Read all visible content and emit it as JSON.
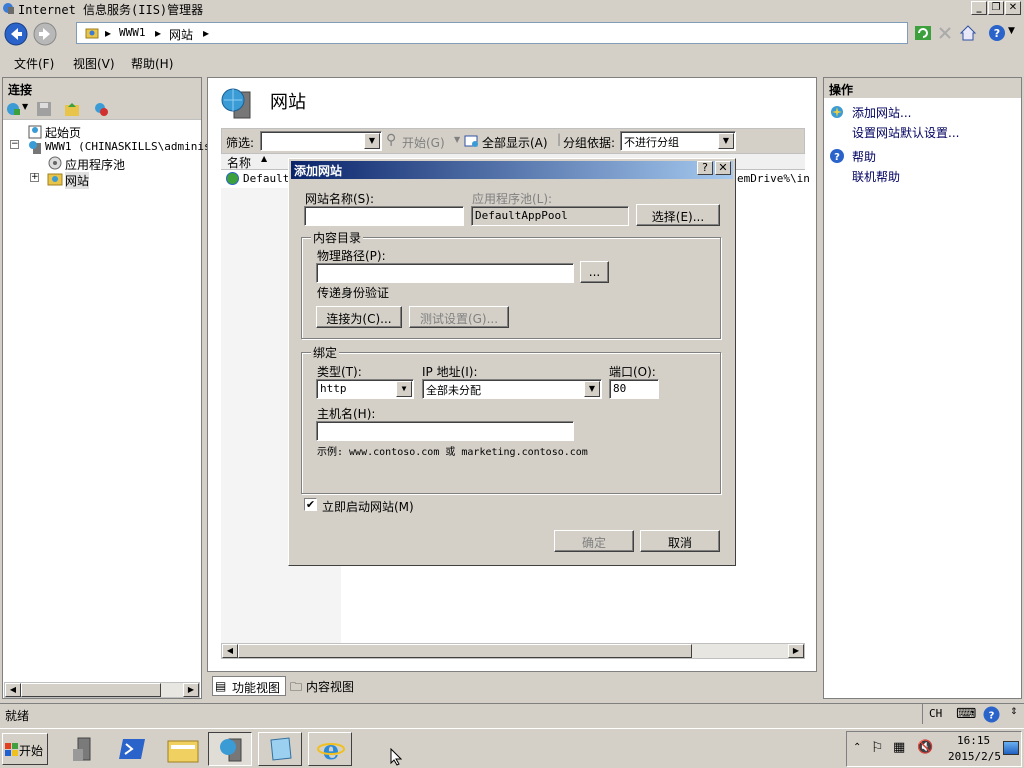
{
  "window": {
    "title": "Internet 信息服务(IIS)管理器"
  },
  "address": {
    "crumbs": [
      "WWW1",
      "网站"
    ]
  },
  "menu": {
    "file": "文件(F)",
    "view": "视图(V)",
    "help": "帮助(H)"
  },
  "connections": {
    "header": "连接",
    "tree": {
      "start_page": "起始页",
      "server": "WWW1 (CHINASKILLS\\administ",
      "app_pools": "应用程序池",
      "sites": "网站"
    }
  },
  "main": {
    "title": "网站",
    "filter_label": "筛选:",
    "start_label": "开始(G)",
    "show_all": "全部显示(A)",
    "group_by_label": "分组依据:",
    "group_by_value": "不进行分组",
    "col_name": "名称",
    "row_default": "Default",
    "row_path_frag": "emDrive%\\in"
  },
  "bottom_tabs": {
    "features": "功能视图",
    "content": "内容视图"
  },
  "actions": {
    "header": "操作",
    "add_site": "添加网站...",
    "set_defaults": "设置网站默认设置...",
    "help": "帮助",
    "online_help": "联机帮助"
  },
  "status": {
    "text": "就绪",
    "lang": "CH"
  },
  "dialog": {
    "title": "添加网站",
    "help_btn": "?",
    "site_name_label": "网站名称(S):",
    "site_name_value": "",
    "app_pool_label": "应用程序池(L):",
    "app_pool_value": "DefaultAppPool",
    "select_btn": "选择(E)...",
    "content_group": "内容目录",
    "physical_path_label": "物理路径(P):",
    "physical_path_value": "",
    "browse_btn": "...",
    "pass_through_label": "传递身份验证",
    "connect_as_btn": "连接为(C)...",
    "test_settings_btn": "测试设置(G)...",
    "binding_group": "绑定",
    "type_label": "类型(T):",
    "type_value": "http",
    "ip_label": "IP 地址(I):",
    "ip_value": "全部未分配",
    "port_label": "端口(O):",
    "port_value": "80",
    "host_label": "主机名(H):",
    "host_value": "",
    "example_text": "示例: www.contoso.com 或 marketing.contoso.com",
    "start_immediately_label": "立即启动网站(M)",
    "start_immediately_checked": true,
    "ok_btn": "确定",
    "cancel_btn": "取消"
  },
  "taskbar": {
    "start": "开始",
    "time": "16:15",
    "date": "2015/2/5"
  },
  "colors": {
    "dialog_title_start": "#0a246a",
    "dialog_title_end": "#a6caf0",
    "chrome": "#d4d0c8"
  }
}
